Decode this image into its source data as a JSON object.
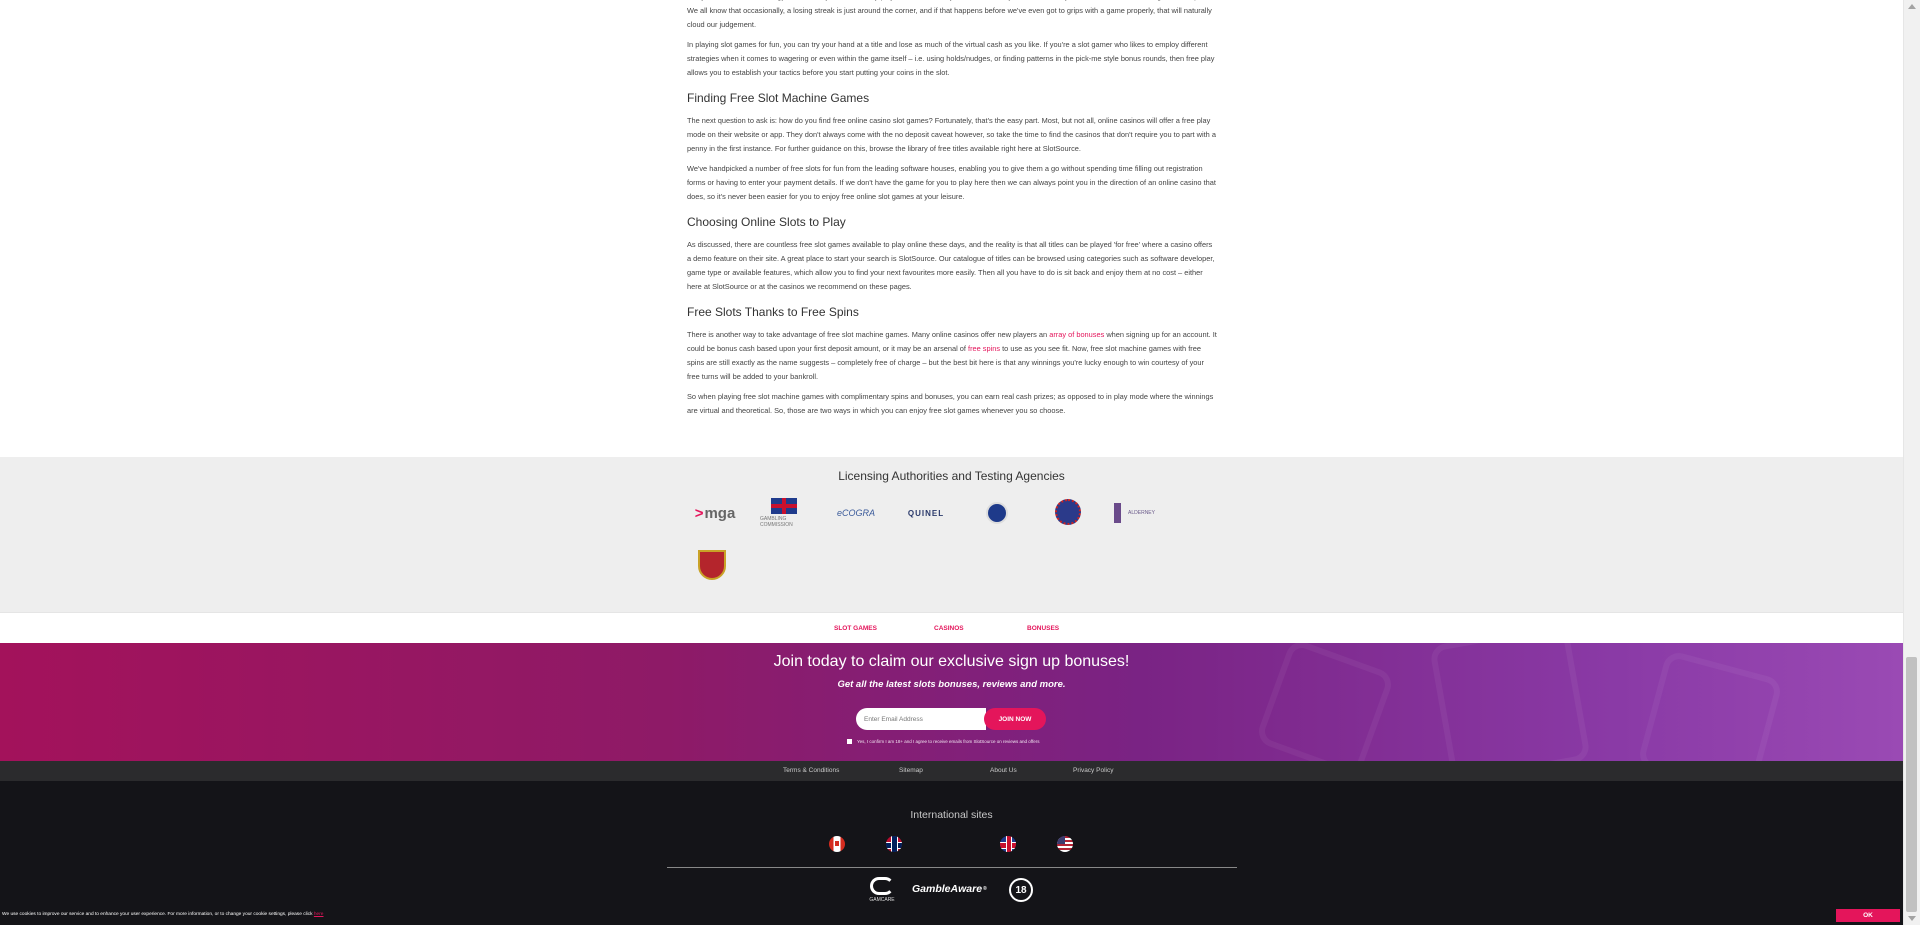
{
  "article": {
    "p0": "and you can devise a strategy to take into your real money play without risk. They are also are easy to find these days, with most casinos offering a demo option. We all know that occasionally, a losing streak is just around the corner, and if that happens before we've even got to grips with a game properly, that will naturally cloud our judgement.",
    "p1": "In playing slot games for fun, you can try your hand at a title and lose as much of the virtual cash as you like. If you're a slot gamer who likes to employ different strategies when it comes to wagering or even within the game itself – i.e. using holds/nudges, or finding patterns in the pick-me style bonus rounds, then free play allows you to establish your tactics before you start putting your coins in the slot.",
    "h_finding": "Finding Free Slot Machine Games",
    "p2": "The next question to ask is: how do you find free online casino slot games? Fortunately, that's the easy part. Most, but not all, online casinos will offer a free play mode on their website or app. They don't always come with the no deposit caveat however, so take the time to find the casinos that don't require you to part with a penny in the first instance. For further guidance on this, browse the library of free titles available right here at SlotSource.",
    "p3": "We've handpicked a number of free slots for fun from the leading software houses, enabling you to give them a go without spending time filling out registration forms or having to enter your payment details. If we don't have the game for you to play here then we can always point you in the direction of an online casino that does, so it's never been easier for you to enjoy free online slot games at your leisure.",
    "h_choosing": "Choosing Online Slots to Play",
    "p4": "As discussed, there are countless free slot games available to play online these days, and the reality is that all titles can be played 'for free' where a casino offers a demo feature on their site. A great place to start your search is SlotSource. Our catalogue of titles can be browsed using categories such as software developer, game type or available features, which allow you to find your next favourites more easily. Then all you have to do is sit back and enjoy them at no cost – either here at SlotSource or at the casinos we recommend on these pages.",
    "h_spins": "Free Slots Thanks to Free Spins",
    "p5_a": "There is another way to take advantage of free slot machine games. Many online casinos offer new players an ",
    "p5_link1": "array of bonuses",
    "p5_b": " when signing up for an account. It could be bonus cash based upon your first deposit amount, or it may be an arsenal of ",
    "p5_link2": "free spins",
    "p5_c": " to use as you see fit. Now, free slot machine games with free spins are still exactly as the name suggests – completely free of charge – but the best bit here is that any winnings you're lucky enough to win courtesy of your free turns will be added to your bankroll.",
    "p6": "So when playing free slot machine games with complimentary spins and bonuses, you can earn real cash prizes; as opposed to in play mode where the winnings are virtual and theoretical. So, those are two ways in which you can enjoy free slot games whenever you so choose."
  },
  "licensing": {
    "title": "Licensing Authorities and Testing Agencies",
    "mga": "mga",
    "gc": "GAMBLING COMMISSION",
    "cogra": "eCOGRA",
    "quinel": "QUINEL",
    "alderney": "ALDERNEY"
  },
  "footnav": {
    "slot_games": "SLOT GAMES",
    "casinos": "CASINOS",
    "bonuses": "BONUSES"
  },
  "signup": {
    "title": "Join today to claim our exclusive sign up bonuses!",
    "subtitle": "Get all the latest slots bonuses, reviews and more.",
    "email_placeholder": "Enter Email Address",
    "join_label": "JOIN NOW",
    "consent": "Yes, I confirm I am 18+ and I agree to receive emails from SlotSource on reviews and offers"
  },
  "legal": {
    "terms": "Terms & Conditions",
    "sitemap": "Sitemap",
    "about": "About Us",
    "privacy": "Privacy Policy"
  },
  "footer": {
    "intl_title": "International sites",
    "gamcare": "GAMCARE",
    "gambleaware": "GambleAware",
    "gambleaware_suffix": "®",
    "age": "18"
  },
  "cookie": {
    "message": "We use cookies to improve our service and to enhance your user experience. For more information, or to change your cookie settings, please click ",
    "link": "here",
    "ok": "OK"
  },
  "colors": {
    "accent": "#e4155b",
    "dark": "#141418",
    "licensing_bg": "#eeeeee"
  }
}
